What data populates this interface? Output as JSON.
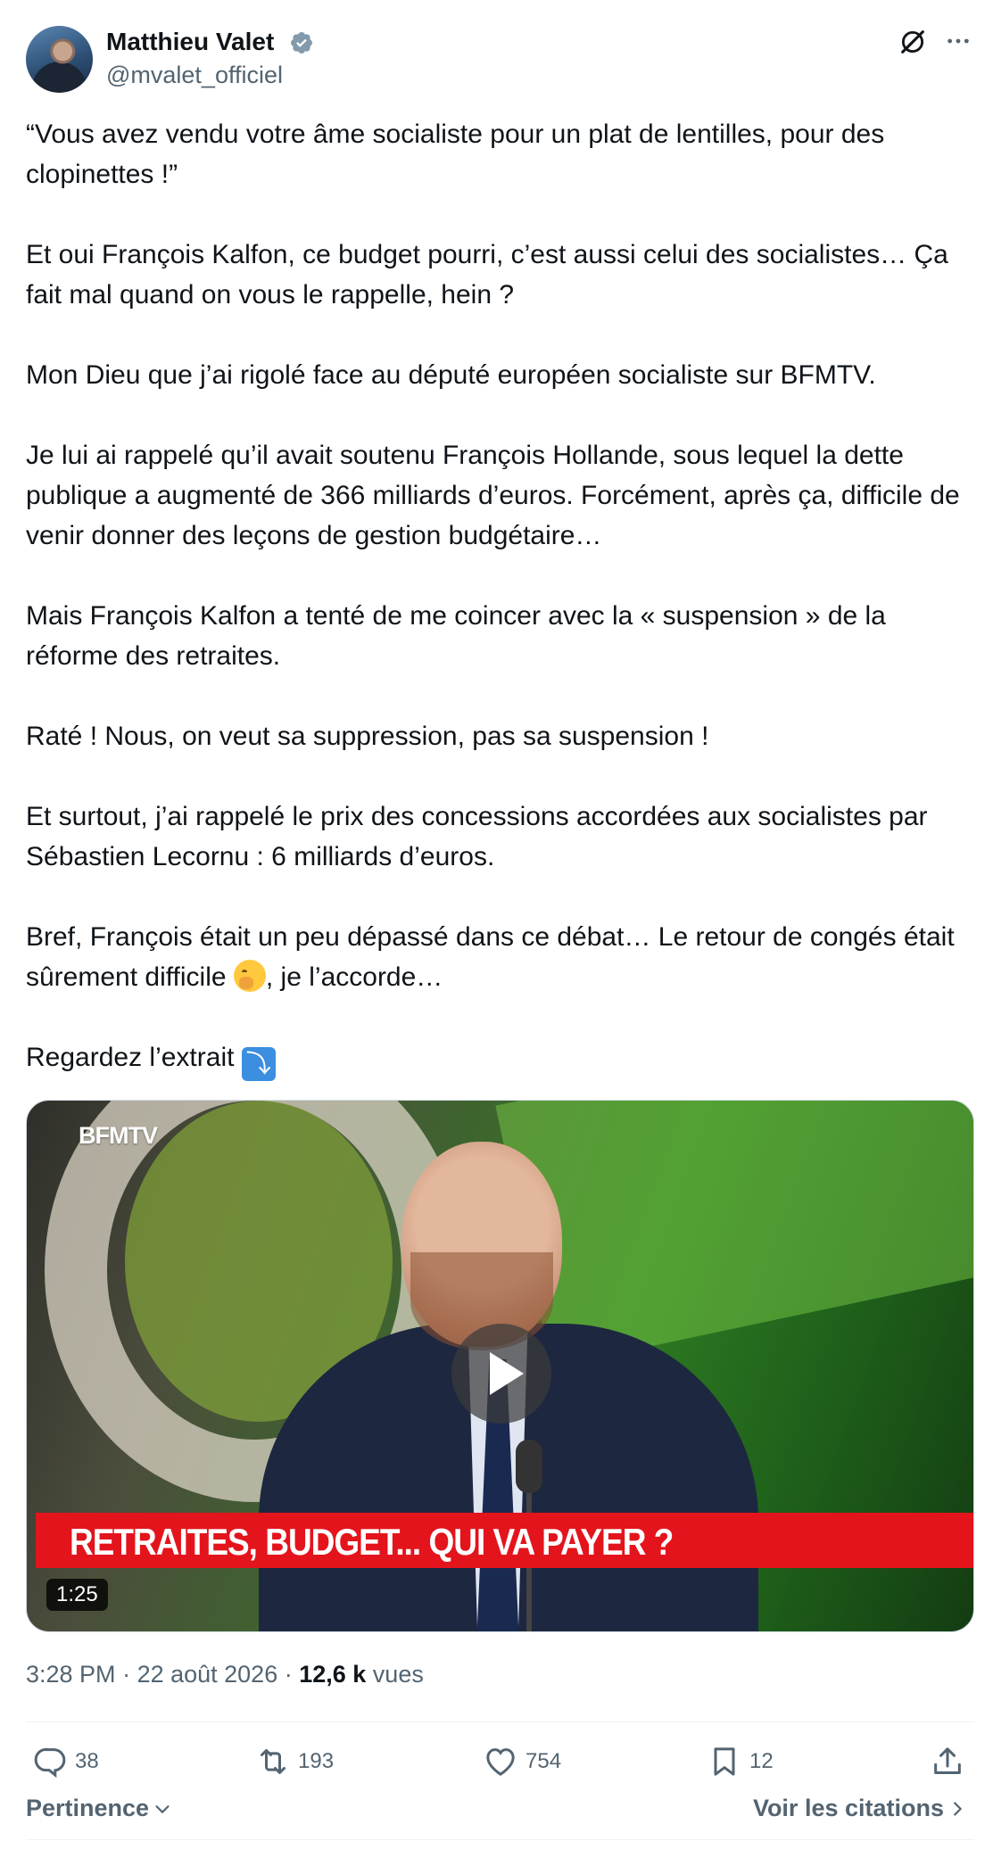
{
  "author": {
    "name": "Matthieu Valet",
    "handle": "@mvalet_officiel",
    "verified": true,
    "verified_color": "#829aab"
  },
  "header_icons": [
    "grok-icon",
    "more-icon"
  ],
  "tweet": {
    "paragraphs": [
      "“Vous avez vendu votre âme socialiste pour un plat de lentilles, pour des clopinettes !”",
      "Et oui François Kalfon, ce budget pourri, c’est aussi celui des socialistes… Ça fait mal quand on vous le rappelle, hein ?",
      "Mon Dieu que j’ai rigolé face au député européen socialiste sur BFMTV.",
      "Je lui ai rappelé qu’il avait soutenu François Hollande, sous lequel la dette publique a augmenté de 366 milliards d’euros. Forcément, après ça, difficile de venir donner des leçons de gestion budgétaire…",
      "Mais François Kalfon a tenté de me coincer avec la « suspension » de la réforme des retraites.",
      "Raté ! Nous, on veut sa suppression, pas sa suspension !",
      "Et surtout, j’ai rappelé le prix des concessions accordées aux socialistes par Sébastien Lecornu : 6 milliards d’euros."
    ],
    "paragraph_8_before_emoji": "Bref, François était un peu dépassé dans ce débat… Le retour de congés était sûrement difficile ",
    "paragraph_8_emoji": "face-with-hand-over-mouth",
    "paragraph_8_after_emoji": ", je l’accorde…",
    "paragraph_9_text": "Regardez l’extrait ",
    "paragraph_9_emoji": "arrow-down-right-emoji"
  },
  "media": {
    "channel_logo": "BFMTV",
    "banner_text": "RETRAITES, BUDGET... QUI VA PAYER ?",
    "duration": "1:25",
    "banner_color": "#e3141c"
  },
  "meta": {
    "time": "3:28 PM",
    "separator": " · ",
    "date": "22 août 2026",
    "views_count": "12,6 k",
    "views_label": " vues"
  },
  "actions": {
    "replies": "38",
    "reposts": "193",
    "likes": "754",
    "bookmarks": "12"
  },
  "footer": {
    "sort_label": "Pertinence",
    "quotes_label": "Voir les citations"
  },
  "colors": {
    "text": "#0f1419",
    "secondary": "#536471",
    "divider": "#eff3f4"
  }
}
